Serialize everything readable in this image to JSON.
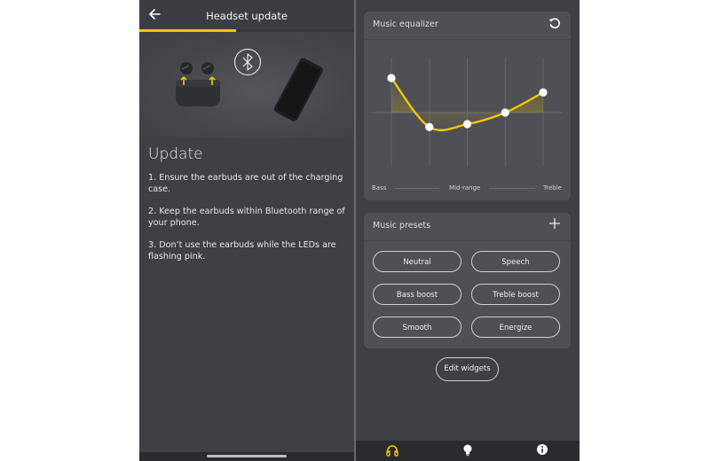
{
  "left_screen": {
    "header": {
      "back_icon": "arrow-left-icon",
      "title": "Headset update"
    },
    "progress": {
      "fraction": 0.45,
      "color": "#f6c700"
    },
    "hero": {
      "icons": [
        "earbuds-case-icon",
        "bluetooth-icon",
        "phone-icon"
      ]
    },
    "section_title": "Update",
    "steps": [
      "1. Ensure the earbuds are out of the charging case.",
      "2. Keep the earbuds within Bluetooth range of your phone.",
      "3. Don’t use the earbuds while the LEDs are flashing pink."
    ]
  },
  "right_screen": {
    "equalizer": {
      "title": "Music equalizer",
      "reset_icon": "reset-icon",
      "bands": [
        {
          "index": 1,
          "level": 0.6
        },
        {
          "index": 2,
          "level": -0.25
        },
        {
          "index": 3,
          "level": -0.2
        },
        {
          "index": 4,
          "level": 0.0
        },
        {
          "index": 5,
          "level": 0.35
        }
      ],
      "labels": {
        "low": "Bass",
        "mid": "Mid-range",
        "high": "Treble"
      },
      "accent_color": "#f6c700"
    },
    "presets": {
      "title": "Music presets",
      "add_icon": "plus-icon",
      "items": [
        "Neutral",
        "Speech",
        "Bass boost",
        "Treble boost",
        "Smooth",
        "Energize"
      ]
    },
    "edit_widgets_label": "Edit widgets",
    "bottom_nav": [
      {
        "icon": "headphones-icon",
        "active": true,
        "color": "#f6c700"
      },
      {
        "icon": "lightbulb-icon",
        "active": false,
        "color": "#ffffff"
      },
      {
        "icon": "info-icon",
        "active": false,
        "color": "#ffffff"
      }
    ]
  }
}
